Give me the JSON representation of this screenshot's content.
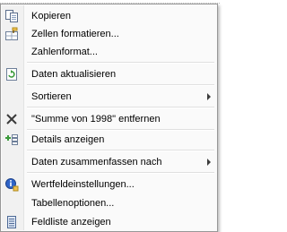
{
  "menu": {
    "copy": "Kopieren",
    "format_cells": "Zellen formatieren...",
    "number_format": "Zahlenformat...",
    "refresh_data": "Daten aktualisieren",
    "sort": "Sortieren",
    "remove_field": "\"Summe von 1998\" entfernen",
    "show_details": "Details anzeigen",
    "summarize_by": "Daten zusammenfassen nach",
    "field_settings": "Wertfeldeinstellungen...",
    "table_options": "Tabellenoptionen...",
    "field_list": "Feldliste anzeigen"
  }
}
